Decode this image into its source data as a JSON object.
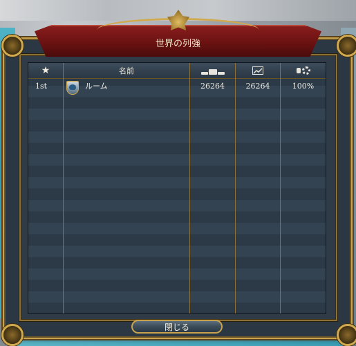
{
  "window": {
    "title": "世界の列強"
  },
  "table": {
    "headers": {
      "rank_icon": "star-icon",
      "name": "名前",
      "score_icon": "score-stack-icon",
      "growth_icon": "chart-icon",
      "admin_icon": "gear-coins-icon"
    },
    "rows": [
      {
        "rank": "1st",
        "name": "ルーム",
        "score": "26264",
        "growth": "26264",
        "percent": "100%"
      }
    ]
  },
  "footer": {
    "close_label": "閉じる"
  },
  "colors": {
    "gold": "#c9a24e",
    "banner_red": "#8b1e1e",
    "panel": "#2b3844"
  }
}
